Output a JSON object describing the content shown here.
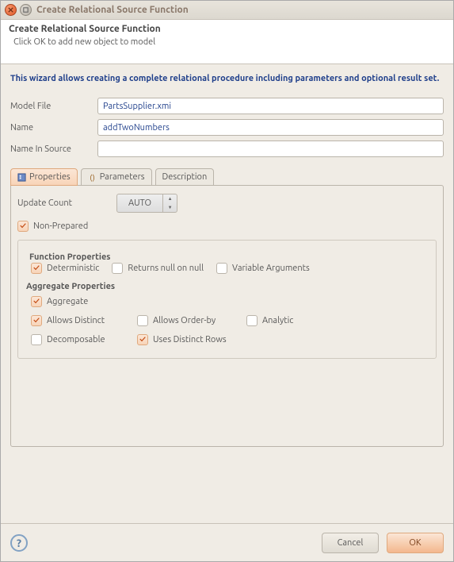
{
  "window": {
    "title": "Create Relational Source Function"
  },
  "banner": {
    "title": "Create Relational Source Function",
    "subtitle": "Click OK to add new object to model"
  },
  "wizard_desc": "This wizard allows creating a complete relational procedure including parameters and optional result set.",
  "fields": {
    "model_file": {
      "label": "Model File",
      "value": "PartsSupplier.xmi"
    },
    "name": {
      "label": "Name",
      "value": "addTwoNumbers"
    },
    "name_in_source": {
      "label": "Name In Source",
      "value": ""
    }
  },
  "tabs": {
    "properties": "Properties",
    "parameters": "Parameters",
    "description": "Description"
  },
  "props": {
    "update_count": {
      "label": "Update Count",
      "value": "AUTO"
    },
    "non_prepared": {
      "label": "Non-Prepared",
      "checked": true
    },
    "function_group": "Function Properties",
    "deterministic": {
      "label": "Deterministic",
      "checked": true
    },
    "returns_null": {
      "label": "Returns null on null",
      "checked": false
    },
    "var_args": {
      "label": "Variable Arguments",
      "checked": false
    },
    "agg_title": "Aggregate Properties",
    "aggregate": {
      "label": "Aggregate",
      "checked": true
    },
    "allows_distinct": {
      "label": "Allows Distinct",
      "checked": true
    },
    "allows_orderby": {
      "label": "Allows Order-by",
      "checked": false
    },
    "analytic": {
      "label": "Analytic",
      "checked": false
    },
    "decomposable": {
      "label": "Decomposable",
      "checked": false
    },
    "uses_distinct_rows": {
      "label": "Uses Distinct Rows",
      "checked": true
    }
  },
  "footer": {
    "help": "?",
    "cancel": "Cancel",
    "ok": "OK"
  }
}
